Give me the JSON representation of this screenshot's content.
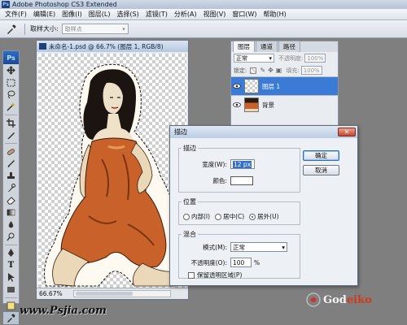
{
  "window": {
    "app_icon": "Ps",
    "title": "Adobe Photoshop CS3 Extended"
  },
  "menu": [
    {
      "label": "文件(F)"
    },
    {
      "label": "编辑(E)"
    },
    {
      "label": "图像(I)"
    },
    {
      "label": "图层(L)"
    },
    {
      "label": "选择(S)"
    },
    {
      "label": "滤镜(T)"
    },
    {
      "label": "分析(A)"
    },
    {
      "label": "视图(V)"
    },
    {
      "label": "窗口(W)"
    },
    {
      "label": "帮助(H)"
    }
  ],
  "options_bar": {
    "sample_size_label": "取样大小:",
    "sample_size_value": "取样点"
  },
  "toolbox": {
    "logo": "Ps"
  },
  "document": {
    "title": "未命名-1.psd @ 66.7% (图层 1, RGB/8)",
    "zoom": "66.67%"
  },
  "layers_panel": {
    "tabs": [
      {
        "label": "图层"
      },
      {
        "label": "通道"
      },
      {
        "label": "路径"
      }
    ],
    "blend_mode": "正常",
    "opacity_label": "不透明度:",
    "opacity_value": "100%",
    "lock_label": "锁定:",
    "fill_label": "填充:",
    "fill_value": "100%",
    "layers": [
      {
        "name": "图层 1",
        "selected": true
      },
      {
        "name": "背景",
        "selected": false
      }
    ]
  },
  "stroke_dialog": {
    "title": "描边",
    "stroke_group": {
      "label": "描边",
      "width_label": "宽度(W):",
      "width_value": "12 px",
      "color_label": "颜色:"
    },
    "position_group": {
      "label": "位置",
      "options": [
        {
          "label": "内部(I)"
        },
        {
          "label": "居中(C)"
        },
        {
          "label": "居外(U)"
        }
      ],
      "selected": "居外(U)"
    },
    "blend_group": {
      "label": "混合",
      "mode_label": "模式(M):",
      "mode_value": "正常",
      "opacity_label": "不透明度(O):",
      "opacity_value": "100",
      "opacity_unit": "%",
      "preserve_label": "保留透明区域(P)"
    },
    "ok_label": "确定",
    "cancel_label": "取消"
  },
  "watermark": {
    "url": "www.Psjia.com",
    "brand_main": "God",
    "brand_accent": "eiko"
  }
}
